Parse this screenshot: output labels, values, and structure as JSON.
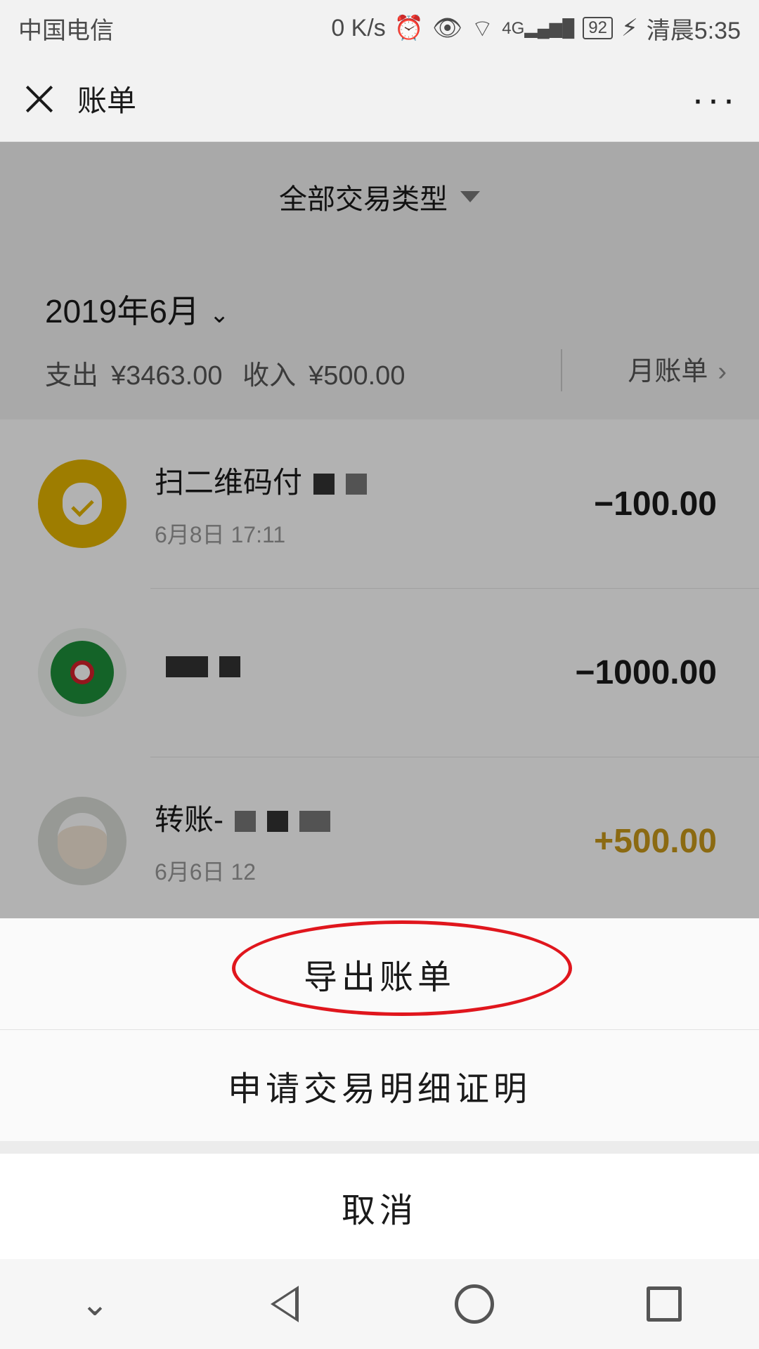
{
  "status_bar": {
    "carrier": "中国电信",
    "net_speed": "0 K/s",
    "network": "4G",
    "battery": "92",
    "time": "清晨5:35"
  },
  "header": {
    "title": "账单",
    "more": "···"
  },
  "filter": {
    "label": "全部交易类型"
  },
  "month": {
    "label": "2019年6月",
    "expense_label": "支出",
    "expense": "¥3463.00",
    "income_label": "收入",
    "income": "¥500.00",
    "monthly_bill": "月账单"
  },
  "transactions": [
    {
      "title": "扫二维码付",
      "time": "6月8日 17:11",
      "amount": "−100.00",
      "icon": "money-bag-icon"
    },
    {
      "title": "",
      "time": "",
      "amount": "−1000.00",
      "icon": "bank-logo-icon"
    },
    {
      "title": "转账-",
      "time": "6月6日 12",
      "amount": "+500.00",
      "icon": "avatar-photo"
    }
  ],
  "sheet": {
    "export": "导出账单",
    "certificate": "申请交易明细证明",
    "cancel": "取消"
  },
  "colors": {
    "income": "#c8981a",
    "highlight": "#e0161d",
    "icon_gold": "#e2b400"
  }
}
